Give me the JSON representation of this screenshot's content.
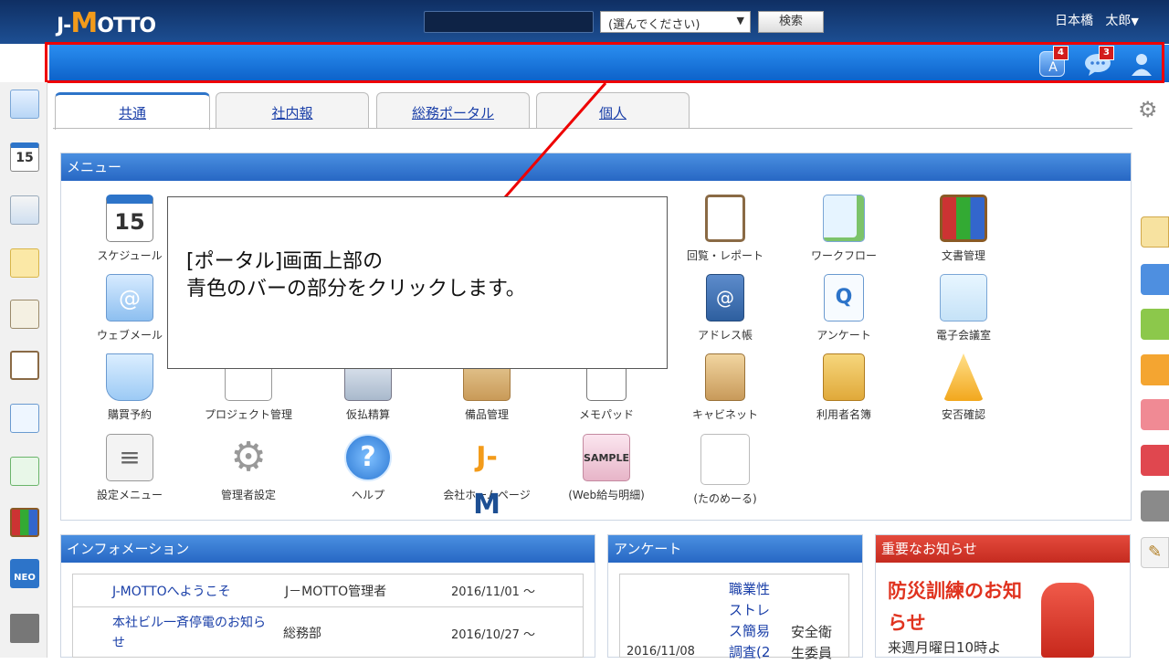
{
  "header": {
    "logo": {
      "left": "J-",
      "m": "M",
      "right": "OTTO"
    },
    "search_placeholder": "",
    "select_value": "(選んでください)",
    "search_button": "検索",
    "user_location": "日本橋",
    "user_name": "太郎"
  },
  "bluebar": {
    "badges": [
      "4",
      "3"
    ]
  },
  "tabs": [
    {
      "label": "共通",
      "active": true
    },
    {
      "label": "社内報",
      "active": false
    },
    {
      "label": "総務ポータル",
      "active": false
    },
    {
      "label": "個人",
      "active": false
    }
  ],
  "menu_panel": {
    "title": "メニュー",
    "items": [
      {
        "label": "スケジュール",
        "icon": "calendar-icon"
      },
      {
        "label": "回覧・レポート",
        "icon": "clipboard-icon"
      },
      {
        "label": "ワークフロー",
        "icon": "workflow-icon"
      },
      {
        "label": "文書管理",
        "icon": "binders-icon"
      },
      {
        "label": "ウェブメール",
        "icon": "mail-icon"
      },
      {
        "label": "アドレス帳",
        "icon": "address-book-icon"
      },
      {
        "label": "アンケート",
        "icon": "survey-icon"
      },
      {
        "label": "電子会議室",
        "icon": "meeting-icon"
      },
      {
        "label": "購買予約",
        "icon": "cart-icon"
      },
      {
        "label": "プロジェクト管理",
        "icon": "gantt-icon"
      },
      {
        "label": "仮払精算",
        "icon": "calculator-icon"
      },
      {
        "label": "備品管理",
        "icon": "box-icon"
      },
      {
        "label": "メモパッド",
        "icon": "memo-icon"
      },
      {
        "label": "キャビネット",
        "icon": "cabinet-icon"
      },
      {
        "label": "利用者名簿",
        "icon": "directory-icon"
      },
      {
        "label": "安否確認",
        "icon": "alert-icon"
      },
      {
        "label": "設定メニュー",
        "icon": "settings-icon"
      },
      {
        "label": "管理者設定",
        "icon": "admin-gear-icon"
      },
      {
        "label": "ヘルプ",
        "icon": "help-icon"
      },
      {
        "label": "会社ホームページ",
        "icon": "jm-logo-icon"
      },
      {
        "label": "(Web給与明細)",
        "icon": "sample-icon"
      },
      {
        "label": "(たのめーる)",
        "icon": "tanomeru-icon"
      }
    ]
  },
  "callout": {
    "line1": "[ポータル]画面上部の",
    "line2": "青色のバーの部分をクリックします。"
  },
  "info_panel": {
    "title": "インフォメーション",
    "rows": [
      {
        "title": "J-MOTTOへようこそ",
        "author": "J－MOTTO管理者",
        "date": "2016/11/01 ～"
      },
      {
        "title": "本社ビル一斉停電のお知らせ",
        "author": "総務部",
        "date": "2016/10/27 ～"
      }
    ]
  },
  "survey_panel": {
    "title": "アンケート",
    "date": "2016/11/08",
    "item_title": "職業性ストレス簡易調査(2",
    "item_dept": "安全衛生委員"
  },
  "notice_panel": {
    "title": "重要なお知らせ",
    "headline": "防災訓練のお知らせ",
    "body": "来週月曜日10時よ"
  }
}
